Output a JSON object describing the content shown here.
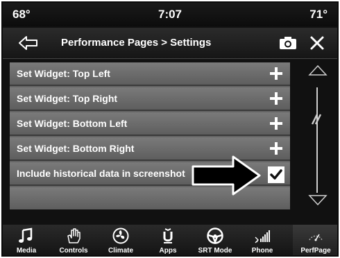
{
  "status": {
    "temp_left": "68°",
    "time": "7:07",
    "temp_right": "71°"
  },
  "header": {
    "title": "Performance Pages > Settings"
  },
  "list": {
    "items": [
      {
        "label": "Set Widget: Top Left",
        "action": "plus"
      },
      {
        "label": "Set Widget: Top Right",
        "action": "plus"
      },
      {
        "label": "Set Widget: Bottom Left",
        "action": "plus"
      },
      {
        "label": "Set Widget: Bottom Right",
        "action": "plus"
      },
      {
        "label": "Include historical data in screenshot",
        "action": "checkbox",
        "checked": true
      }
    ]
  },
  "nav": {
    "items": [
      {
        "label": "Media",
        "icon": "music-note-icon"
      },
      {
        "label": "Controls",
        "icon": "hand-icon"
      },
      {
        "label": "Climate",
        "icon": "fan-icon"
      },
      {
        "label": "Apps",
        "icon": "apps-icon"
      },
      {
        "label": "SRT Mode",
        "icon": "steering-wheel-icon"
      },
      {
        "label": "Phone",
        "icon": "phone-bluetooth-icon"
      },
      {
        "label": "PerfPage",
        "icon": "perfpage-icon",
        "active": true
      }
    ]
  },
  "colors": {
    "background": "#111111",
    "row": "#6e6e6e",
    "text": "#ffffff"
  }
}
